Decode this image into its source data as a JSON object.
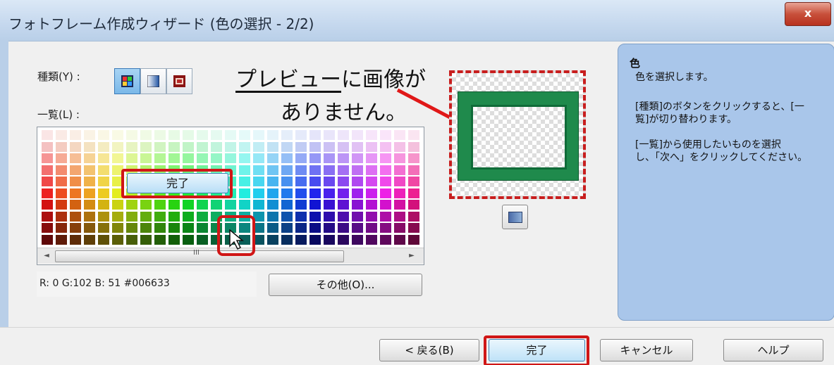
{
  "window": {
    "title": "フォトフレーム作成ウィザード (色の選択 - 2/2)",
    "close_label": "x"
  },
  "left": {
    "type_label": "種類(Y) :",
    "list_label": "一覧(L) :",
    "type_buttons": [
      "palette-icon",
      "gradient-icon",
      "frame-pattern-icon"
    ]
  },
  "annotation": {
    "line1_underlined": "プレビュー",
    "line1_rest": "に画像が",
    "line2": "ありません。"
  },
  "palette": {
    "overlay_button_label": "完了",
    "scroll_grip": "III",
    "scroll_left": "◄",
    "scroll_right": "►"
  },
  "rgb_readout": "R:  0  G:102  B: 51   #006633",
  "other_button_label": "その他(O)...",
  "help": {
    "title": "色",
    "line1": "色を選択します。",
    "para2_line1": "[種類]のボタンをクリックすると、[一",
    "para2_line2": "覧]が切り替わります。",
    "para3_line1": "[一覧]から使用したいものを選択",
    "para3_line2": "し、「次へ」をクリックしてください。"
  },
  "buttons": {
    "back": "< 戻る(B)",
    "finish": "完了",
    "cancel": "キャンセル",
    "help": "ヘルプ"
  },
  "colors": {
    "highlight_red": "#d01616",
    "selected_color": "#006633",
    "help_panel_bg": "#a9c6ea"
  }
}
